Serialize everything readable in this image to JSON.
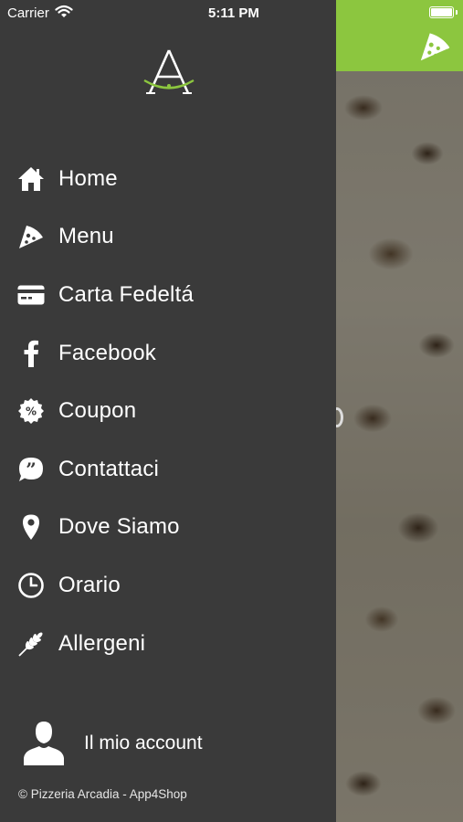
{
  "status_bar": {
    "carrier": "Carrier",
    "time": "5:11 PM"
  },
  "brand": {
    "logo_letter": "A",
    "accent_color": "#8cc63f"
  },
  "menu": {
    "items": [
      {
        "label": "Home",
        "icon": "home-icon"
      },
      {
        "label": "Menu",
        "icon": "pizza-slice-icon"
      },
      {
        "label": "Carta Fedeltá",
        "icon": "credit-card-icon"
      },
      {
        "label": "Facebook",
        "icon": "facebook-icon"
      },
      {
        "label": "Coupon",
        "icon": "percent-badge-icon"
      },
      {
        "label": "Contattaci",
        "icon": "chat-quote-icon"
      },
      {
        "label": "Dove Siamo",
        "icon": "map-pin-icon"
      },
      {
        "label": "Orario",
        "icon": "clock-icon"
      },
      {
        "label": "Allergeni",
        "icon": "wheat-icon"
      }
    ]
  },
  "account": {
    "label": "Il mio account",
    "icon": "user-icon"
  },
  "footer": {
    "text": "© Pizzeria Arcadia - App4Shop"
  }
}
